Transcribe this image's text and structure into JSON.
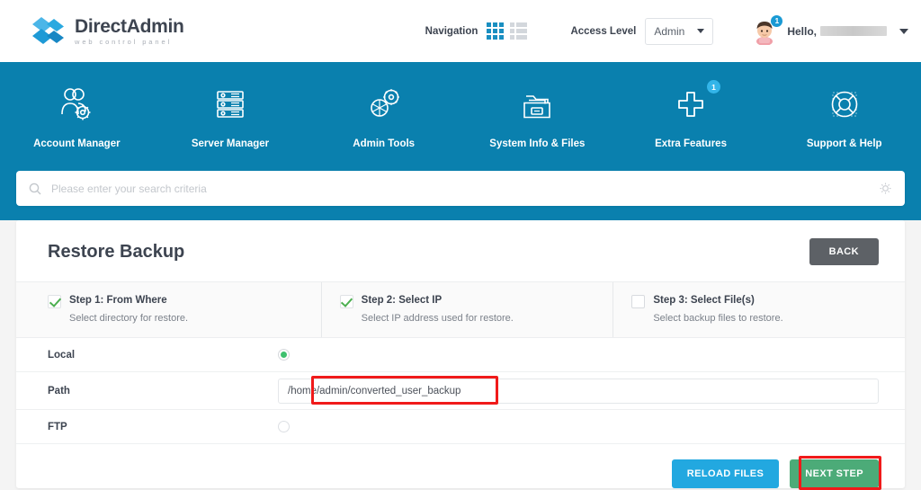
{
  "brand": {
    "title_bold": "Direct",
    "title_light": "Admin",
    "subtitle": "web control panel",
    "logo_icon": "chevrons-logo-icon",
    "accent_blue": "#0a80ae",
    "accent_light_blue": "#33b5e9"
  },
  "topbar": {
    "navigation_label": "Navigation",
    "grid_view_icon": "grid-view-icon",
    "list_view_icon": "list-view-icon",
    "access_level_label": "Access Level",
    "access_level_value": "Admin",
    "avatar_icon": "user-avatar-icon",
    "avatar_badge": "1",
    "greeting": "Hello,",
    "username_redacted": ""
  },
  "mainnav": {
    "items": [
      {
        "label": "Account Manager",
        "icon": "users-gear-icon",
        "badge": ""
      },
      {
        "label": "Server Manager",
        "icon": "server-rack-icon",
        "badge": ""
      },
      {
        "label": "Admin Tools",
        "icon": "gears-tools-icon",
        "badge": ""
      },
      {
        "label": "System Info & Files",
        "icon": "folder-files-icon",
        "badge": ""
      },
      {
        "label": "Extra Features",
        "icon": "plus-icon",
        "badge": "1"
      },
      {
        "label": "Support & Help",
        "icon": "lifebuoy-icon",
        "badge": ""
      }
    ]
  },
  "search": {
    "placeholder": "Please enter your search criteria",
    "value": "",
    "search_icon": "search-icon",
    "settings_icon": "gear-icon"
  },
  "page": {
    "title": "Restore Backup",
    "back_label": "BACK"
  },
  "steps": [
    {
      "title": "Step 1: From Where",
      "desc": "Select directory for restore.",
      "state": "checked",
      "icon": "check-icon"
    },
    {
      "title": "Step 2: Select IP",
      "desc": "Select IP address used for restore.",
      "state": "checked",
      "icon": "check-icon"
    },
    {
      "title": "Step 3: Select File(s)",
      "desc": "Select backup files to restore.",
      "state": "unchecked",
      "icon": "empty-checkbox-icon"
    }
  ],
  "form": {
    "local_label": "Local",
    "local_selected": true,
    "path_label": "Path",
    "path_value": "/home/admin/converted_user_backup",
    "ftp_label": "FTP",
    "ftp_selected": false
  },
  "footer": {
    "reload_label": "RELOAD FILES",
    "next_label": "NEXT STEP"
  },
  "annotations": {
    "color": "#f01a1a",
    "boxes": [
      "path-input-highlight",
      "next-step-highlight"
    ]
  }
}
